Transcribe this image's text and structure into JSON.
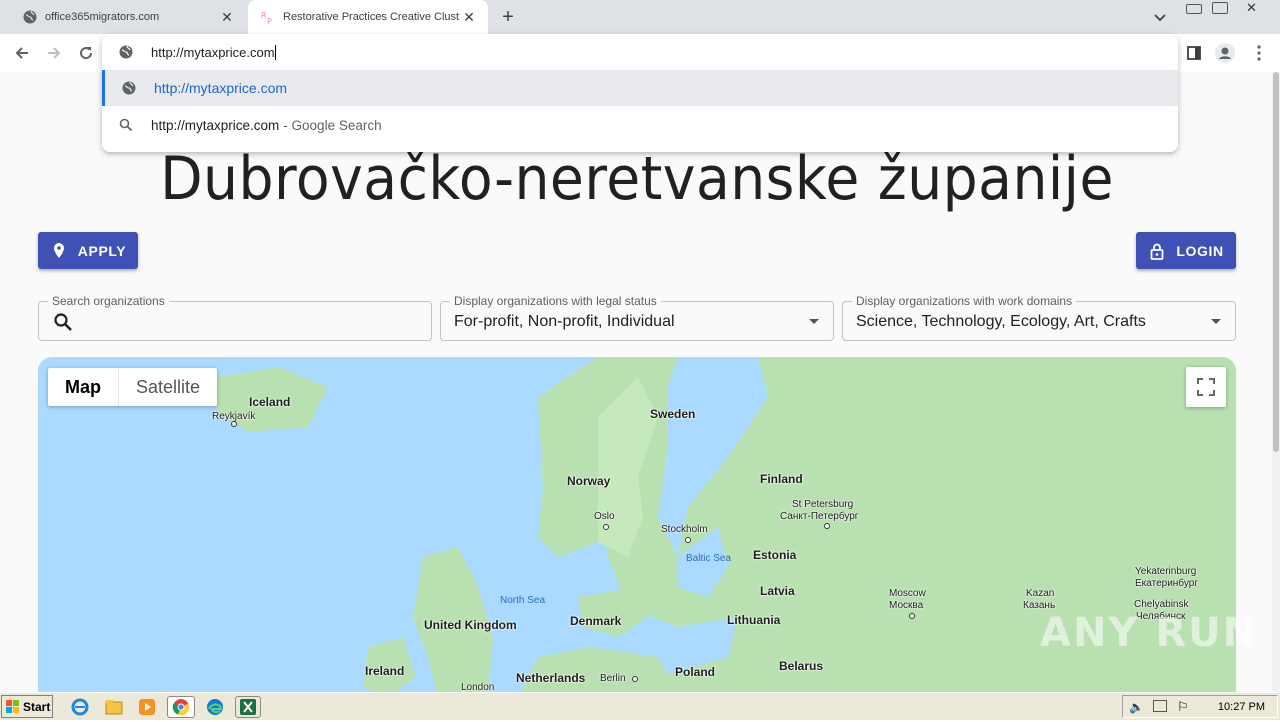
{
  "tabs": [
    {
      "title": "office365migrators.com",
      "icon": "globe-icon",
      "active": false
    },
    {
      "title": "Restorative Practices Creative Clust",
      "icon": "rp-favicon",
      "active": true
    }
  ],
  "omnibox": {
    "value": "http://mytaxprice.com",
    "suggestions": [
      {
        "text": "http://mytaxprice.com",
        "icon": "globe-icon"
      },
      {
        "text": "http://mytaxprice.com",
        "suffix": "- Google Search",
        "icon": "search-icon"
      }
    ]
  },
  "page": {
    "heading": "Dubrovačko-neretvanske županije",
    "apply_label": "APPLY",
    "login_label": "LOGIN",
    "filters": {
      "search_label": "Search organizations",
      "search_value": "",
      "legal_label": "Display organizations with legal status",
      "legal_value": "For-profit, Non-profit, Individual",
      "domain_label": "Display organizations with work domains",
      "domain_value": "Science, Technology, Ecology, Art, Crafts"
    },
    "map": {
      "type_map": "Map",
      "type_satellite": "Satellite",
      "labels": {
        "iceland": "Iceland",
        "reykjavik": "Reykjavík",
        "sweden": "Sweden",
        "norway": "Norway",
        "finland": "Finland",
        "oslo": "Oslo",
        "stockholm": "Stockholm",
        "st_petersburg": "St Petersburg",
        "st_petersburg_ru": "Санкт-Петербург",
        "baltic_sea": "Baltic Sea",
        "estonia": "Estonia",
        "latvia": "Latvia",
        "lithuania": "Lithuania",
        "north_sea": "North Sea",
        "denmark": "Denmark",
        "united_kingdom": "United Kingdom",
        "ireland": "Ireland",
        "london": "London",
        "netherlands": "Netherlands",
        "berlin": "Berlin",
        "poland": "Poland",
        "belarus": "Belarus",
        "moscow": "Moscow",
        "moscow_ru": "Москва",
        "kazan": "Kazan",
        "kazan_ru": "Казань",
        "yekaterinburg": "Yekaterinburg",
        "yekaterinburg_ru": "Екатеринбург",
        "chelyabinsk": "Chelyabinsk",
        "chelyabinsk_ru": "Челябинск"
      }
    },
    "watermark": "ANY RUN"
  },
  "taskbar": {
    "start_label": "Start",
    "clock": "10:27 PM"
  },
  "colors": {
    "primary": "#3f51b5",
    "map_water": "#aadaff",
    "map_land": "#b8e0b0"
  }
}
